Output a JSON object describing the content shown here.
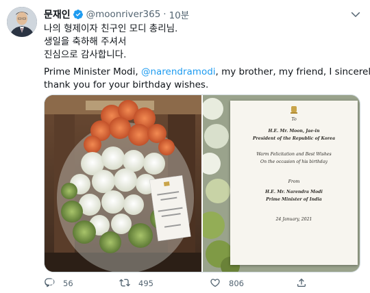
{
  "author": {
    "display_name": "문재인",
    "handle": "@moonriver365",
    "separator": "·",
    "time": "10분"
  },
  "tweet": {
    "korean_lines": [
      "나의 형제이자 친구인 모디 총리님.",
      "생일을 축하해 주셔서",
      "진심으로 감사합니다."
    ],
    "english_prefix": "Prime Minister Modi, ",
    "mention": "@narendramodi",
    "english_suffix": ", my brother, my friend, I sincerely",
    "english_line2": "thank you for your birthday wishes."
  },
  "card": {
    "to": "To",
    "recipient": "H.E. Mr. Moon, Jae-in",
    "recipient_title": "President of the Republic of Korea",
    "wish_line1": "Warm Felicitation and Best Wishes",
    "wish_line2": "On the occasion of his birthday",
    "from": "From",
    "sender": "H.E. Mr. Narendra Modi",
    "sender_title": "Prime Minister of India",
    "date": "24 January, 2021"
  },
  "actions": {
    "replies": "56",
    "retweets": "495",
    "likes": "806"
  },
  "colors": {
    "accent": "#1d9bf0",
    "secondary_text": "#536471",
    "primary_text": "#0f1419",
    "border": "#cfd9de"
  },
  "icons": [
    "verified-badge-icon",
    "chevron-down-icon",
    "reply-icon",
    "retweet-icon",
    "like-icon",
    "share-icon"
  ]
}
